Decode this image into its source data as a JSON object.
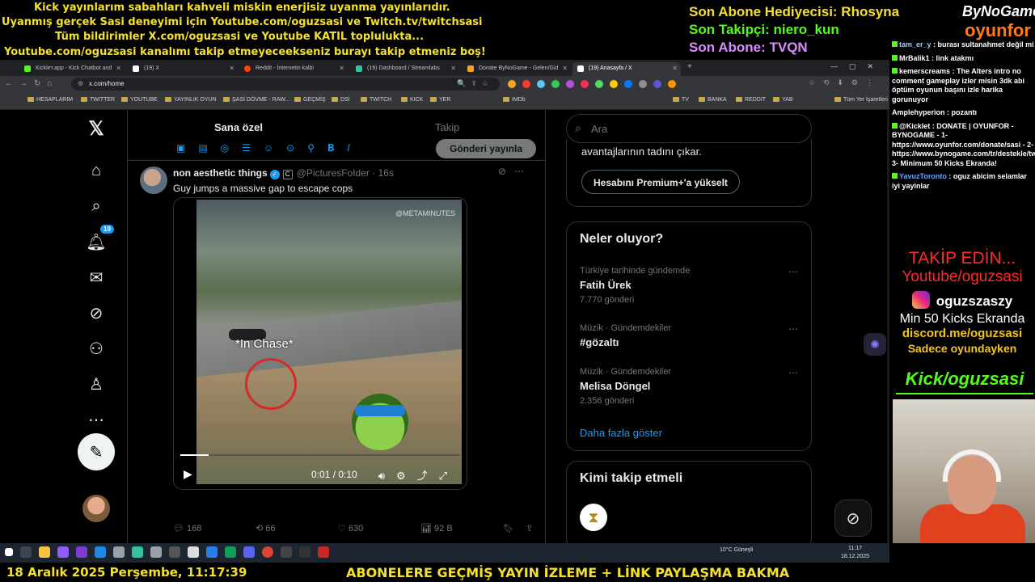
{
  "overlay": {
    "ticker_lines": [
      "Kick yayınlarım sabahları kahveli miskin enerjisiz uyanma yayınlarıdır.",
      "Uyanmış gerçek Sasi deneyimi için Youtube.com/oguzsasi ve Twitch.tv/twitchsasi",
      "Tüm bildirimler X.com/oguzsasi ve Youtube KATIL toplulukta...",
      "Youtube.com/oguzsasi kanalımı takip etmeyeceekseniz burayı takip etmeniz boş!"
    ],
    "last_gifter": "Son Abone Hediyecisi: Rhosyna",
    "last_follower": "Son Takipçi: niero_kun",
    "last_sub": "Son Abone: TVQN",
    "brand_top": "ByNoGame",
    "brand_bottom": "oyunfor",
    "bottom_date": "18 Aralık 2025 Perşembe, 11:17:39",
    "bottom_marquee": "ABONELERE GEÇMİŞ YAYIN İZLEME + LİNK PAYLAŞMA BAKMA",
    "colors": {
      "ticker": "#f5e12b",
      "gifter": "#f5e12b",
      "follower": "#53fc18",
      "sub": "#d98cff"
    }
  },
  "browser": {
    "tabs": [
      {
        "label": "Kickleт.app - Kick Chatbot and",
        "color": "#53fc18"
      },
      {
        "label": "(19) X",
        "color": "#ffffff"
      },
      {
        "label": "Reddit - İnternetin kalbi",
        "color": "#ff4500"
      },
      {
        "label": "(19) Dashboard / Streamlabs",
        "color": "#31c3a2"
      },
      {
        "label": "Donate ByNoGame - Gelen/Gid",
        "color": "#f6a623"
      },
      {
        "label": "(19) Anasayfa / X",
        "color": "#ffffff"
      }
    ],
    "url": "x.com/home",
    "bookmarks": [
      "HESAPLARIM",
      "TWITTER",
      "YOUTUBE",
      "YAYINLIK OYUN",
      "ŞASİ DÖVME - RAW...",
      "GEÇMİŞ",
      "DSİ",
      "TWITCH",
      "KICK",
      "YER",
      "IMDb",
      "TV",
      "BANKA",
      "REDDIT",
      "YAB",
      "Tüm Yer İşaretleri"
    ]
  },
  "x": {
    "notifications_badge": "19",
    "tabs": {
      "for_you": "Sana özel",
      "following": "Takip"
    },
    "post_button": "Gönderi yayınla",
    "tweet": {
      "name": "non aesthetic things",
      "handle": "@PicturesFoIder",
      "time": "· 16s",
      "text": "Guy jumps a massive gap to escape cops",
      "video_watermark": "@METAMINUTES",
      "video_caption": "*In Chase*",
      "video_time": "0:01 / 0:10",
      "progress": 0.1,
      "replies": "168",
      "reposts": "66",
      "likes": "630",
      "views": "92 B"
    },
    "search_placeholder": "Ara",
    "premium_text": "avantajlarının tadını çıkar.",
    "premium_button": "Hesabını Premium+'a yükselt",
    "trends_title": "Neler oluyor?",
    "trends": [
      {
        "context": "Türkiye tarihinde gündemde",
        "name": "Fatih Ürek",
        "count": "7.770 gönderi"
      },
      {
        "context": "Müzik · Gündemdekiler",
        "name": "#gözaltı",
        "count": ""
      },
      {
        "context": "Müzik · Gündemdekiler",
        "name": "Melisa Döngel",
        "count": "2.356 gönderi"
      }
    ],
    "show_more": "Daha fazla göster",
    "who_to_follow": "Kimi takip etmeli"
  },
  "taskbar": {
    "weather": "10°C  Güneşli",
    "time": "11:17",
    "date": "18.12.2025"
  },
  "chat": {
    "messages": [
      {
        "user": "tam_er_y",
        "text": ": burası sultanahmet değil mi",
        "color": "#9ecbff"
      },
      {
        "user": "MrBalik1",
        "text": ": link atakmı",
        "color": "#ffffff"
      },
      {
        "user": "kemerscreams",
        "text": ": The Alters intro no comment gameplay izler misin 3dk abi öptüm oyunun başını izle harika gorunuyor",
        "color": "#ffffff"
      },
      {
        "user": "Amplehyperion",
        "text": ": pozantı",
        "color": "#ffffff"
      },
      {
        "user": "@Kicklet",
        "text": ": DONATE | OYUNFOR - BYNOGAME - 1- https://www.oyunfor.com/donate/sasi - 2- https://www.bynogame.com/tr/destekle/twitchsasi 3- Minimum 50 Kicks Ekranda!",
        "color": "#ffffff"
      },
      {
        "user": "YavuzToronto",
        "text": ": oguz abicim selamlar iyi yayinlar",
        "color": "#6aa0ff"
      }
    ]
  },
  "promo": {
    "line1": "TAKİP EDİN...",
    "line2": "Youtube/oguzsasi",
    "instagram": "oguzszaszy",
    "line4": "Min 50 Kicks Ekranda",
    "line5": "discord.me/oguzsasi",
    "line6": "Sadece oyundayken",
    "kick": "Kick/oguzsasi"
  }
}
